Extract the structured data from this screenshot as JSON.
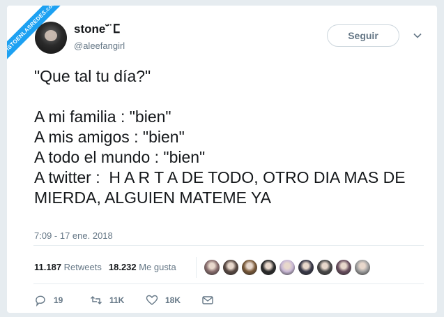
{
  "watermark": "VISTOENLASREDES.com",
  "author": {
    "name": "stone˘̈ ⵎ",
    "handle": "@aleefangirl"
  },
  "follow_label": "Seguir",
  "tweet_text": "\"Que tal tu día?\"\n\nA mi familia : \"bien\"\nA mis amigos : \"bien\"\nA todo el mundo : \"bien\"\nA twitter :  H A R T A DE TODO, OTRO DIA MAS DE MIERDA, ALGUIEN MATEME YA",
  "timestamp": "7:09 - 17 ene. 2018",
  "stats": {
    "retweets_count": "11.187",
    "retweets_label": "Retweets",
    "likes_count": "18.232",
    "likes_label": "Me gusta"
  },
  "liker_avatars": [
    "#8a6f6f",
    "#5a4a44",
    "#7a5a3a",
    "#2b2b2b",
    "#c9b8d6",
    "#3a3a4a",
    "#4a4a4a",
    "#6a5060",
    "#a0a0a0"
  ],
  "actions": {
    "reply_count": "19",
    "retweet_count": "11K",
    "like_count": "18K"
  },
  "colors": {
    "accent": "#1da1f2",
    "secondary_text": "#657786",
    "border": "#e6ecf0"
  }
}
